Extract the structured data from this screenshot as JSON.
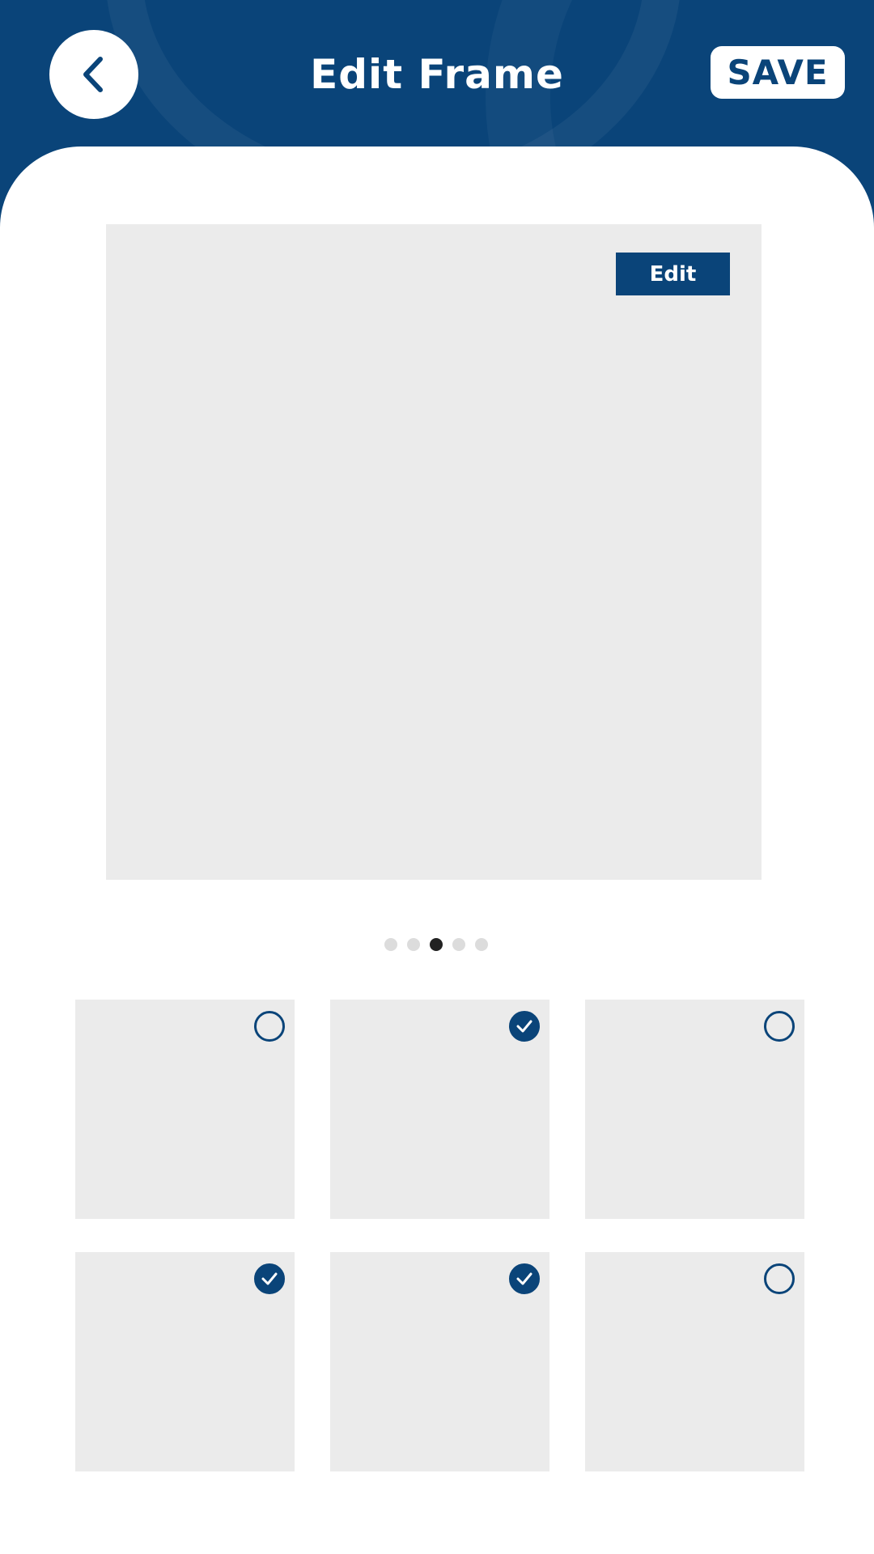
{
  "header": {
    "title": "Edit Frame",
    "save_label": "SAVE",
    "back_icon": "chevron-left-icon"
  },
  "preview": {
    "edit_label": "Edit"
  },
  "pagination": {
    "total": 5,
    "active_index": 2
  },
  "thumbnails": [
    {
      "selected": false
    },
    {
      "selected": true
    },
    {
      "selected": false
    },
    {
      "selected": true
    },
    {
      "selected": true
    },
    {
      "selected": false
    }
  ],
  "colors": {
    "brand": "#0a4479",
    "placeholder": "#ebebeb",
    "dot_inactive": "#dcdcdc",
    "dot_active": "#222222"
  }
}
